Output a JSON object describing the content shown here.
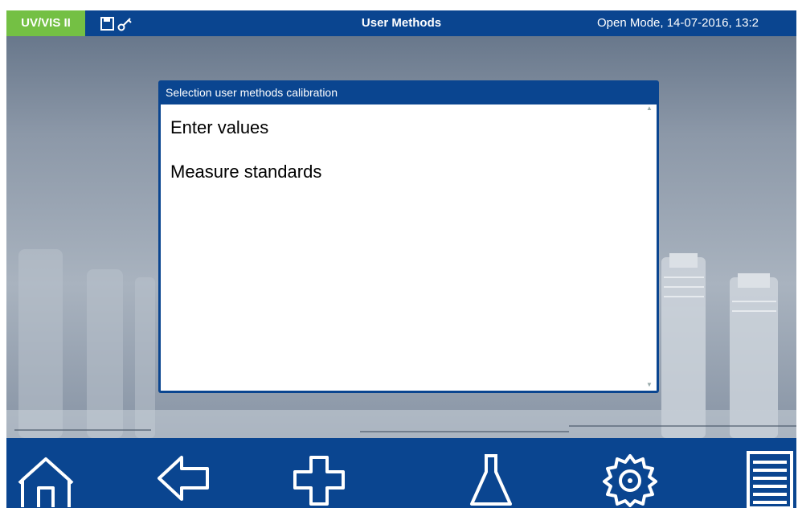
{
  "status_bar": {
    "brand": "UV/VIS II",
    "title": "User Methods",
    "mode_datetime": "Open Mode, 14-07-2016, 13:2",
    "icons": [
      "floppy-disk-icon",
      "key-icon"
    ]
  },
  "dialog": {
    "title": "Selection user methods calibration",
    "items": [
      {
        "label": "Enter values"
      },
      {
        "label": "Measure standards"
      }
    ]
  },
  "nav": {
    "buttons": [
      "home-icon",
      "back-arrow-icon",
      "plus-icon",
      "flask-icon",
      "settings-gear-icon",
      "menu-list-icon"
    ]
  },
  "colors": {
    "bar_blue": "#0a4590",
    "brand_green": "#74c044",
    "text_white": "#ffffff"
  }
}
